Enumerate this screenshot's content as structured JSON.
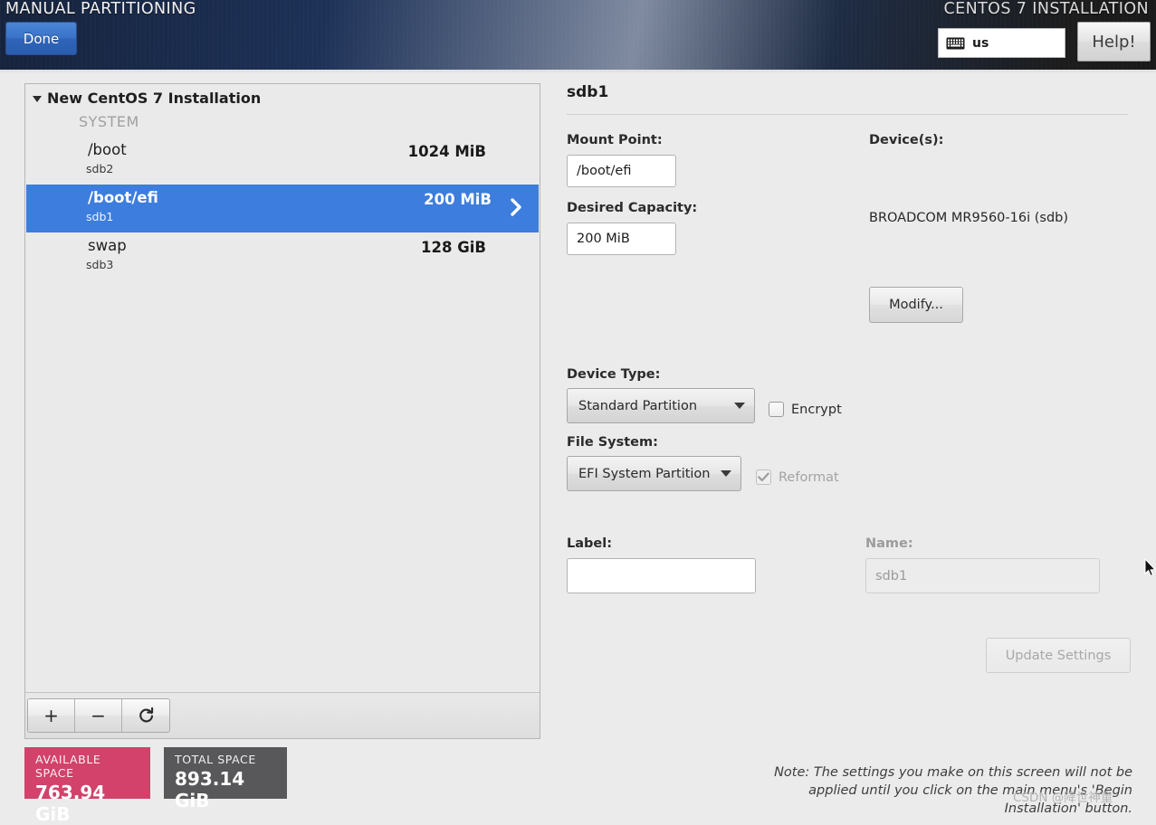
{
  "header": {
    "title_left": "MANUAL PARTITIONING",
    "title_right": "CENTOS 7 INSTALLATION",
    "done_label": "Done",
    "keyboard_layout": "us",
    "keyboard_icon": "keyboard-icon",
    "help_label": "Help!"
  },
  "left": {
    "group_label": "New CentOS 7 Installation",
    "group_expand_icon": "chevron-down-icon",
    "section_label": "SYSTEM",
    "partitions": [
      {
        "mount": "/boot",
        "device": "sdb2",
        "size": "1024 MiB",
        "selected": false
      },
      {
        "mount": "/boot/efi",
        "device": "sdb1",
        "size": "200 MiB",
        "selected": true
      },
      {
        "mount": "swap",
        "device": "sdb3",
        "size": "128 GiB",
        "selected": false
      }
    ],
    "toolbar": [
      {
        "name": "add-partition-button",
        "glyph": "+",
        "icon": "plus-icon"
      },
      {
        "name": "remove-partition-button",
        "glyph": "−",
        "icon": "minus-icon"
      },
      {
        "name": "refresh-partitions-button",
        "glyph": "⟳",
        "icon": "refresh-icon"
      }
    ],
    "space": {
      "available_title": "AVAILABLE SPACE",
      "available_value": "763.94 GiB",
      "available_color": "#d2426a",
      "total_title": "TOTAL SPACE",
      "total_value": "893.14 GiB",
      "total_color": "#58585a"
    }
  },
  "right": {
    "device_title": "sdb1",
    "mount_point_label": "Mount Point:",
    "mount_point_value": "/boot/efi",
    "desired_capacity_label": "Desired Capacity:",
    "desired_capacity_value": "200 MiB",
    "devices_label": "Device(s):",
    "devices_value": "BROADCOM MR9560-16i (sdb)",
    "modify_label": "Modify...",
    "device_type_label": "Device Type:",
    "device_type_value": "Standard Partition",
    "encrypt_label": "Encrypt",
    "encrypt_checked": false,
    "file_system_label": "File System:",
    "file_system_value": "EFI System Partition",
    "reformat_label": "Reformat",
    "reformat_checked": true,
    "label_label": "Label:",
    "label_value": "",
    "name_label": "Name:",
    "name_value": "sdb1",
    "update_settings_label": "Update Settings",
    "note": "Note:  The settings you make on this screen will not be applied until you click on the main menu's 'Begin Installation' button."
  },
  "watermark": "CSDN @降世神童",
  "colors": {
    "selection_blue": "#3d7ddd",
    "done_blue": "#3a72c8",
    "header_navy": "#1d3157",
    "available_pink": "#d2426a",
    "total_gray": "#58585a"
  }
}
